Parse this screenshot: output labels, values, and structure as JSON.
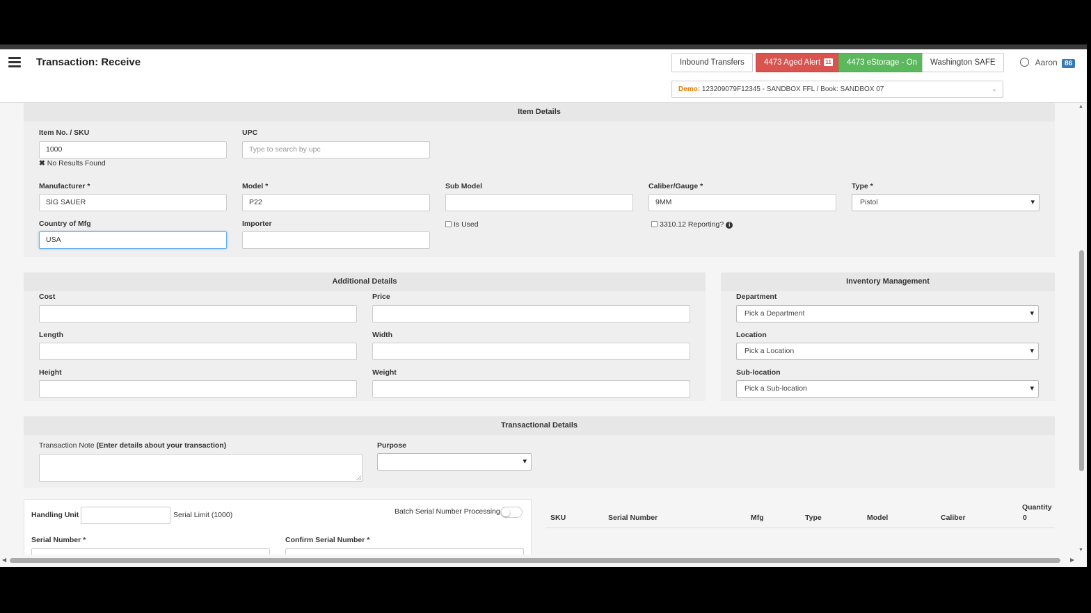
{
  "header": {
    "title": "Transaction: Receive",
    "buttons": {
      "inbound": "Inbound Transfers",
      "aged_alert": "4473 Aged Alert",
      "aged_alert_count": "11",
      "estorage": "4473 eStorage - On",
      "washington": "Washington SAFE"
    },
    "user": {
      "name": "Aaron",
      "badge": "86"
    },
    "demo": {
      "label": "Demo:",
      "value": "123209079F12345 - SANDBOX FFL / Book: SANDBOX 07"
    }
  },
  "item_details": {
    "title": "Item Details",
    "sku": {
      "label": "Item No. / SKU",
      "value": "1000",
      "error": "No Results Found"
    },
    "upc": {
      "label": "UPC",
      "placeholder": "Type to search by upc"
    },
    "manufacturer": {
      "label": "Manufacturer *",
      "value": "SIG SAUER"
    },
    "model": {
      "label": "Model *",
      "value": "P22"
    },
    "sub_model": {
      "label": "Sub Model",
      "value": ""
    },
    "caliber": {
      "label": "Caliber/Gauge *",
      "value": "9MM"
    },
    "type": {
      "label": "Type *",
      "value": "Pistol"
    },
    "country": {
      "label": "Country of Mfg",
      "value": "USA"
    },
    "importer": {
      "label": "Importer",
      "value": ""
    },
    "is_used": "Is Used",
    "reporting": "3310.12 Reporting?"
  },
  "additional_details": {
    "title": "Additional Details",
    "cost": "Cost",
    "price": "Price",
    "length": "Length",
    "width": "Width",
    "height": "Height",
    "weight": "Weight"
  },
  "inventory": {
    "title": "Inventory Management",
    "department": {
      "label": "Department",
      "value": "Pick a Department"
    },
    "location": {
      "label": "Location",
      "value": "Pick a Location"
    },
    "sublocation": {
      "label": "Sub-location",
      "value": "Pick a Sub-location"
    }
  },
  "transactional": {
    "title": "Transactional Details",
    "note_label": "Transaction Note",
    "note_hint": "(Enter details about your transaction)",
    "purpose_label": "Purpose",
    "purpose_value": ""
  },
  "serial": {
    "handling_unit": "Handling Unit",
    "serial_limit": "Serial Limit (1000)",
    "batch": "Batch Serial Number Processing",
    "serial_number": "Serial Number *",
    "confirm_serial": "Confirm Serial Number *"
  },
  "table": {
    "columns": [
      "SKU",
      "Serial Number",
      "Mfg",
      "Type",
      "Model",
      "Caliber"
    ],
    "quantity_label": "Quantity",
    "quantity_value": "0"
  },
  "colors": {
    "red": "#d9534f",
    "green": "#5cb85c",
    "orange": "#e07b00",
    "blue": "#337ab7"
  }
}
